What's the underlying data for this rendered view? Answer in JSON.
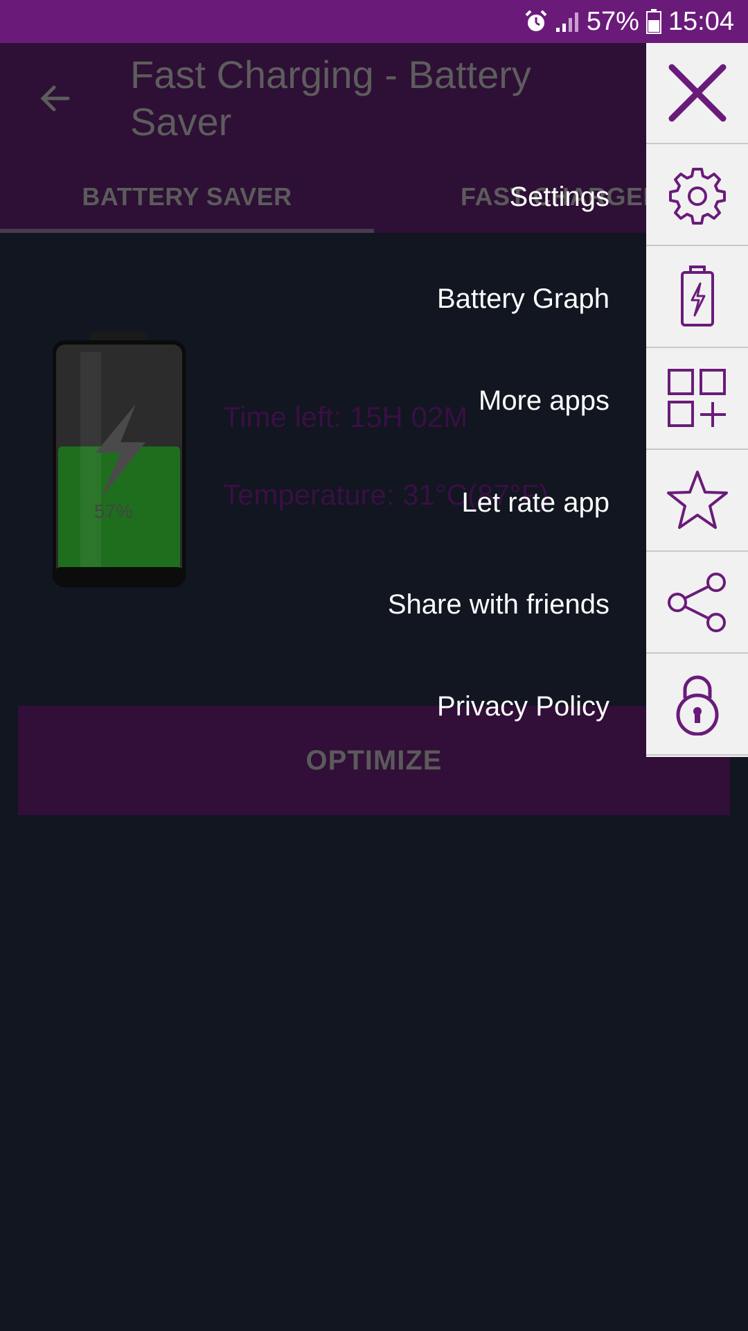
{
  "status_bar": {
    "battery_percent": "57%",
    "time": "15:04"
  },
  "app_bar": {
    "title": "Fast Charging - Battery Saver"
  },
  "tabs": [
    {
      "label": "BATTERY SAVER"
    },
    {
      "label": "FAST CHARGER"
    }
  ],
  "battery": {
    "percent": "57%"
  },
  "info": {
    "time_left": "Time left: 15H 02M",
    "temperature": "Temperature: 31°C(87°F)"
  },
  "optimize_label": "OPTIMIZE",
  "menu": {
    "items": [
      {
        "label": "Settings",
        "icon": "gear-icon"
      },
      {
        "label": "Battery Graph",
        "icon": "battery-charging-icon"
      },
      {
        "label": "More apps",
        "icon": "apps-grid-icon"
      },
      {
        "label": "Let rate app",
        "icon": "star-icon"
      },
      {
        "label": "Share with friends",
        "icon": "share-icon"
      },
      {
        "label": "Privacy Policy",
        "icon": "lock-icon"
      }
    ],
    "close_icon": "close-icon"
  },
  "colors": {
    "accent": "#6a1b7a",
    "panel": "#f1f1f1",
    "icon": "#6a1b7a",
    "battery_fill": "#1e7a1e"
  }
}
